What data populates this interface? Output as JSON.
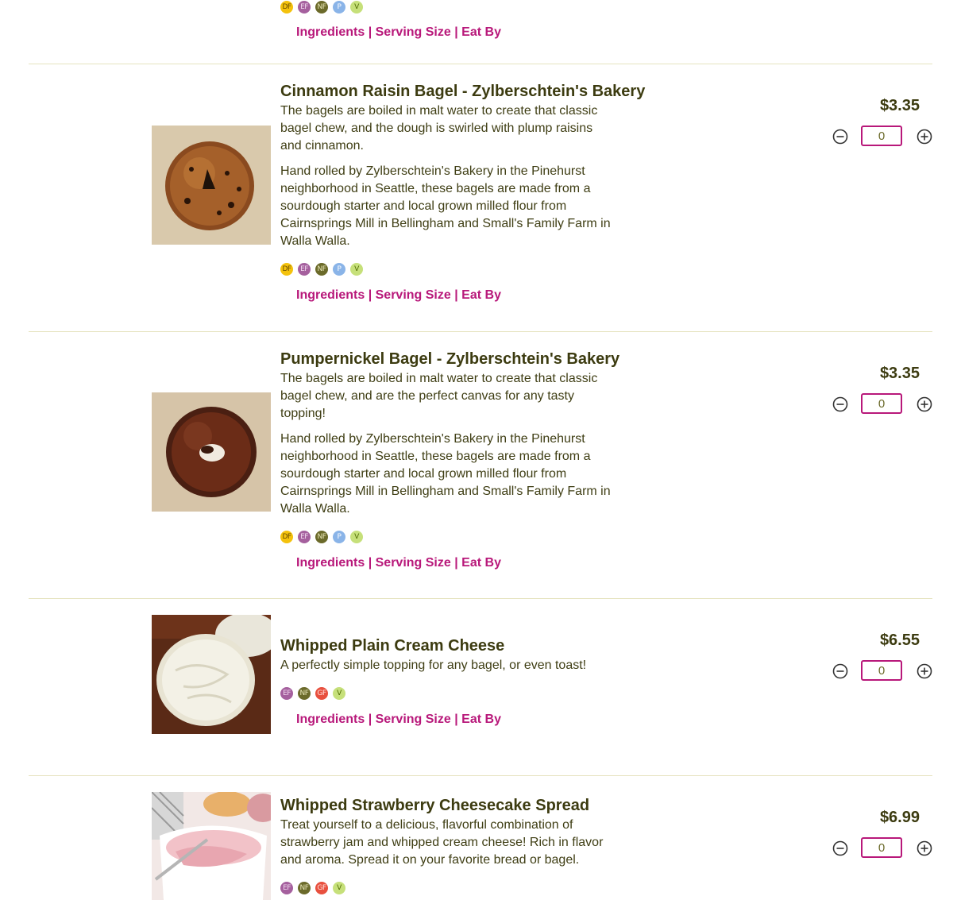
{
  "badge_colors": {
    "DF": {
      "bg": "#f4c20d",
      "fg": "#6a4d00"
    },
    "EF": {
      "bg": "#a5609e",
      "fg": "#f0d7ee"
    },
    "NF": {
      "bg": "#6b6a2a",
      "fg": "#e8e6b8"
    },
    "P": {
      "bg": "#8ab4e8",
      "fg": "#ffffff"
    },
    "V": {
      "bg": "#c6e07a",
      "fg": "#4e6b00"
    },
    "GF": {
      "bg": "#e8503e",
      "fg": "#ffe0dc"
    }
  },
  "link_labels": {
    "ingredients": "Ingredients",
    "serving": "Serving Size",
    "eat_by": "Eat By",
    "separator": "|"
  },
  "top_partial": {
    "badges": [
      "DF",
      "EF",
      "NF",
      "P",
      "V"
    ]
  },
  "products": [
    {
      "title": "Cinnamon Raisin Bagel - Zylberschtein's Bakery",
      "description": [
        "The bagels are boiled in malt water to create that classic bagel chew, and the dough is swirled with plump raisins and cinnamon.",
        "Hand rolled by Zylberschtein's Bakery in the Pinehurst neighborhood in Seattle, these bagels are made from a sourdough starter and local grown milled flour from Cairnsprings Mill in Bellingham and Small's Family Farm in Walla Walla."
      ],
      "badges": [
        "DF",
        "EF",
        "NF",
        "P",
        "V"
      ],
      "price": "$3.35",
      "quantity": "0",
      "image_icon": "cinnamon-raisin-bagel-photo"
    },
    {
      "title": "Pumpernickel Bagel - Zylberschtein's Bakery",
      "description": [
        "The bagels are boiled in malt water to create that classic bagel chew, and are the perfect canvas for any tasty topping!",
        "Hand rolled by Zylberschtein's Bakery in the Pinehurst neighborhood in Seattle, these bagels are made from a sourdough starter and local grown milled flour from Cairnsprings Mill in Bellingham and Small's Family Farm in Walla Walla."
      ],
      "badges": [
        "DF",
        "EF",
        "NF",
        "P",
        "V"
      ],
      "price": "$3.35",
      "quantity": "0",
      "image_icon": "pumpernickel-bagel-photo"
    },
    {
      "title": "Whipped Plain Cream Cheese",
      "description": [
        "A perfectly simple topping for any bagel, or even toast!"
      ],
      "badges": [
        "EF",
        "NF",
        "GF",
        "V"
      ],
      "price": "$6.55",
      "quantity": "0",
      "image_icon": "cream-cheese-photo"
    },
    {
      "title": "Whipped Strawberry Cheesecake Spread",
      "description": [
        "Treat yourself to a delicious, flavorful combination of strawberry jam and whipped cream cheese! Rich in flavor and aroma. Spread it on your favorite bread or bagel."
      ],
      "badges": [
        "EF",
        "NF",
        "GF",
        "V"
      ],
      "price": "$6.99",
      "quantity": "0",
      "image_icon": "strawberry-spread-photo"
    }
  ]
}
